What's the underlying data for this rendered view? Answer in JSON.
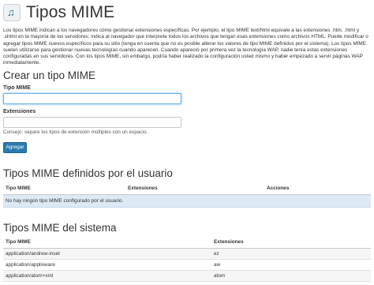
{
  "header": {
    "title": "Tipos MIME",
    "icon": "music-note-icon"
  },
  "description": "Los tipos MIME indican a los navegadores cómo gestionar extensiones específicas. Por ejemplo, el tipo MIME text/html equivale a las extensiones .htm, .html y .shtml en la mayoría de los servidores; indica al navegador que interprete todos los archivos que tengan esas extensiones como archivos HTML. Puede modificar o agregar tipos MIME nuevos específicos para su sitio (tenga en cuenta que no es posible alterar los valores de tipo MIME definidos por el sistema). Los tipos MIME suelen utilizarse para gestionar nuevas tecnologías cuando aparecen. Cuando apareció por primera vez la tecnología WAP, nadie tenía estas extensiones configuradas en sus servidores. Con los tipos MIME, sin embargo, podría haber realizado la configuración usted mismo y haber empezado a servir páginas WAP inmediatamente.",
  "create": {
    "heading": "Crear un tipo MIME",
    "mime_label": "Tipo MIME",
    "mime_value": "",
    "ext_label": "Extensiones",
    "ext_value": "",
    "hint": "Consejo: separe los tipos de extensión múltiples con un espacio.",
    "submit": "Agregar"
  },
  "user_table": {
    "heading": "Tipos MIME definidos por el usuario",
    "columns": [
      "Tipo MIME",
      "Extensiones",
      "Acciones"
    ],
    "empty_message": "No hay ningún tipo MIME configurado por el usuario."
  },
  "system_table": {
    "heading": "Tipos MIME del sistema",
    "columns": [
      "Tipo MIME",
      "Extensiones"
    ],
    "rows": [
      {
        "type": "application/andrew-inset",
        "ext": "ez"
      },
      {
        "type": "application/applixware",
        "ext": "aw"
      },
      {
        "type": "application/atom+xml",
        "ext": "atom"
      }
    ]
  }
}
